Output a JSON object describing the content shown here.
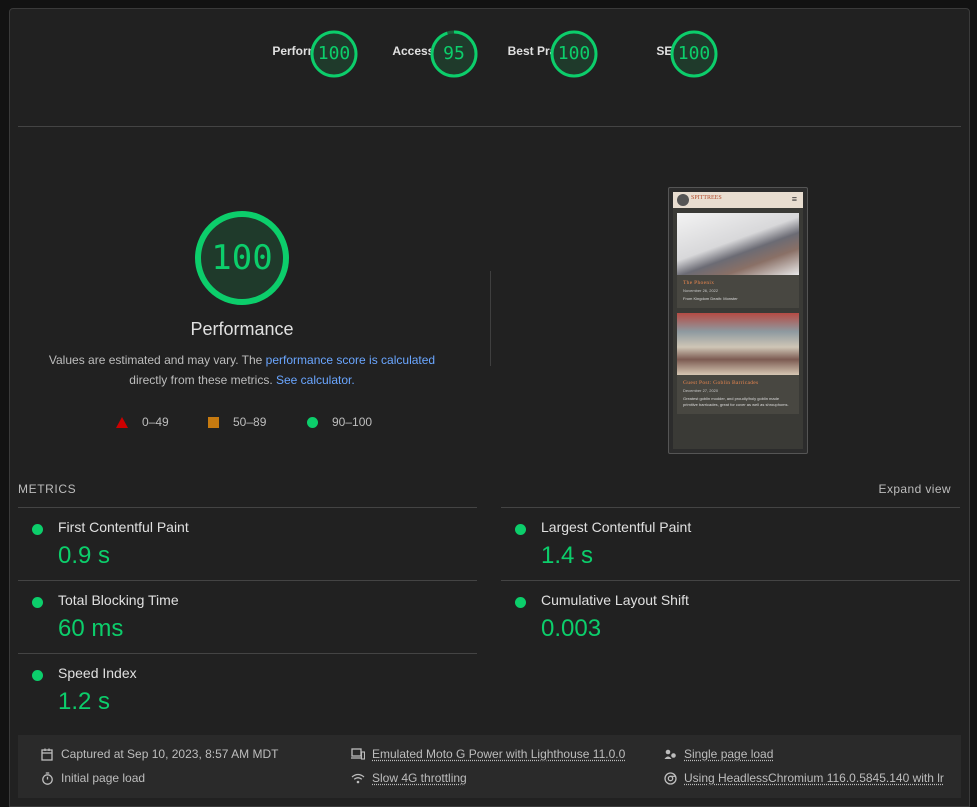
{
  "categories": [
    {
      "label": "Performance",
      "score": 100
    },
    {
      "label": "Accessibility",
      "score": 95
    },
    {
      "label": "Best Practices",
      "score": 100
    },
    {
      "label": "SEO",
      "score": 100
    }
  ],
  "colors": {
    "pass": "#0cce6b",
    "average": "#c67a10",
    "fail": "#cc0000",
    "link": "#6aa6ff"
  },
  "summary": {
    "score": "100",
    "title": "Performance",
    "desc_pre": "Values are estimated and may vary. The ",
    "desc_link1": "performance score is calculated",
    "desc_mid": "directly from these metrics. ",
    "desc_link2": "See calculator."
  },
  "legend": {
    "fail": "0–49",
    "average": "50–89",
    "pass": "90–100"
  },
  "screenshot": {
    "brand": "SPITTREES",
    "post1_title": "The Phoenix",
    "post1_date": "November 26, 2022",
    "post1_text": "From Kingdom Death: Monster",
    "post2_title": "Guest Post: Goblin Barricades",
    "post2_date": "December 27, 2020",
    "post2_text": "Greatest goblin modder, and proudly/holy goblin made primitive barricades, great for cover as well as shrouphoms."
  },
  "metrics": {
    "heading": "METRICS",
    "expand_label": "Expand view",
    "fcp": {
      "label": "First Contentful Paint",
      "value": "0.9 s"
    },
    "lcp": {
      "label": "Largest Contentful Paint",
      "value": "1.4 s"
    },
    "tbt": {
      "label": "Total Blocking Time",
      "value": "60 ms"
    },
    "cls": {
      "label": "Cumulative Layout Shift",
      "value": "0.003"
    },
    "si": {
      "label": "Speed Index",
      "value": "1.2 s"
    }
  },
  "footer": {
    "captured": "Captured at Sep 10, 2023, 8:57 AM MDT",
    "initial": "Initial page load",
    "device": "Emulated Moto G Power with Lighthouse 11.0.0",
    "throttle": "Slow 4G throttling",
    "single": "Single page load",
    "browser": "Using HeadlessChromium 116.0.5845.140 with lr"
  }
}
